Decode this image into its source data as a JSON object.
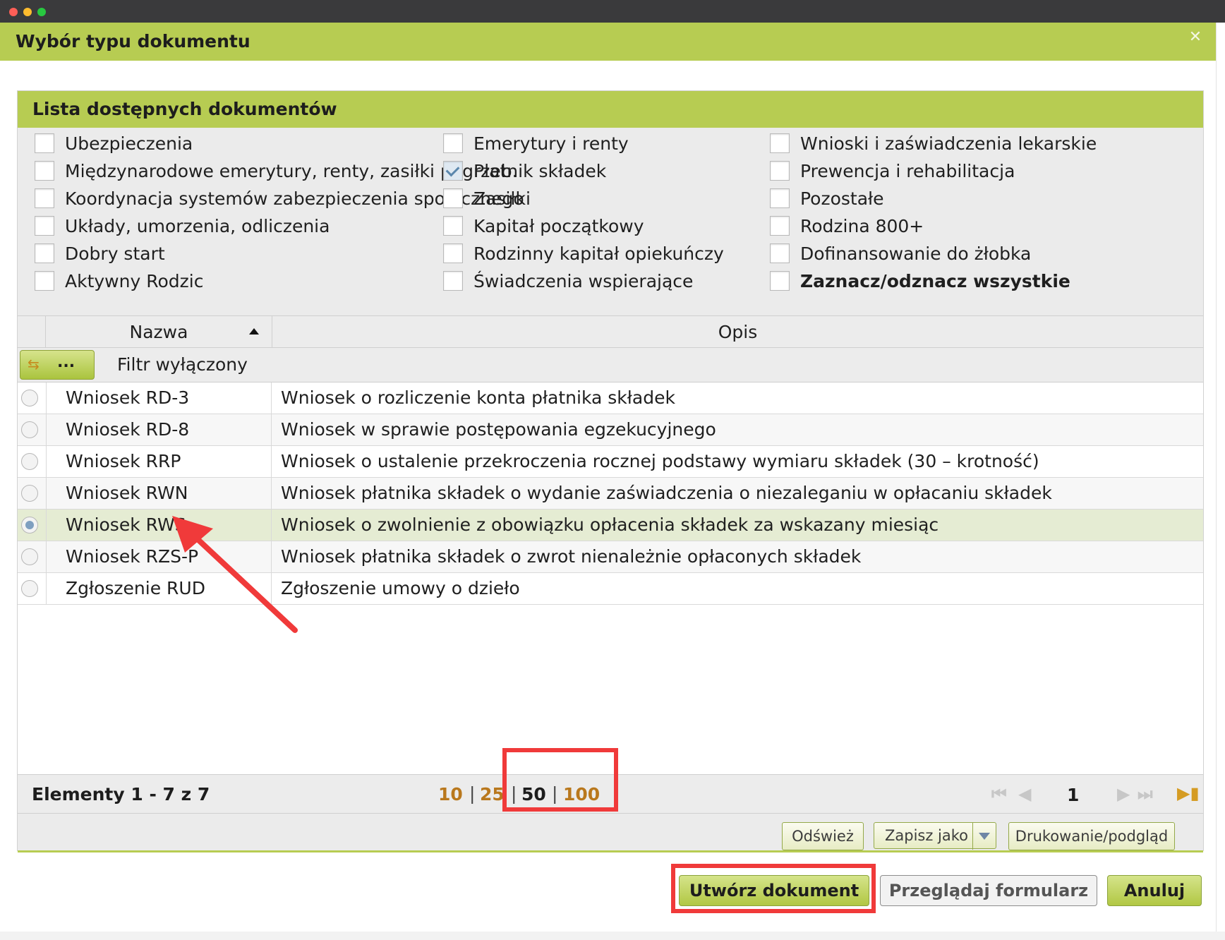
{
  "window": {
    "title": "Wybór typu dokumentu",
    "close_icon": "x-icon"
  },
  "panel": {
    "title": "Lista dostępnych dokumentów",
    "categories": [
      {
        "label": "Ubezpieczenia",
        "checked": false
      },
      {
        "label": "Emerytury i renty",
        "checked": false
      },
      {
        "label": "Wnioski i zaświadczenia lekarskie",
        "checked": false
      },
      {
        "label": "Międzynarodowe emerytury, renty, zasiłki pogrzeb.",
        "checked": false
      },
      {
        "label": "Płatnik składek",
        "checked": true
      },
      {
        "label": "Prewencja i rehabilitacja",
        "checked": false
      },
      {
        "label": "Koordynacja systemów zabezpieczenia społecznego",
        "checked": false
      },
      {
        "label": "Zasiłki",
        "checked": false
      },
      {
        "label": "Pozostałe",
        "checked": false
      },
      {
        "label": "Układy, umorzenia, odliczenia",
        "checked": false
      },
      {
        "label": "Kapitał początkowy",
        "checked": false
      },
      {
        "label": "Rodzina 800+",
        "checked": false
      },
      {
        "label": "Dobry start",
        "checked": false
      },
      {
        "label": "Rodzinny kapitał opiekuńczy",
        "checked": false
      },
      {
        "label": "Dofinansowanie do żłobka",
        "checked": false
      },
      {
        "label": "Aktywny Rodzic",
        "checked": false
      },
      {
        "label": "Świadczenia wspierające",
        "checked": false
      },
      {
        "label": "Zaznacz/odznacz wszystkie",
        "checked": false
      }
    ]
  },
  "grid": {
    "columns": {
      "name": "Nazwa",
      "description": "Opis"
    },
    "filter": {
      "button_label": "...",
      "status": "Filtr wyłączony"
    },
    "rows": [
      {
        "name": "Wniosek RD-3",
        "description": "Wniosek o rozliczenie konta płatnika składek",
        "selected": false
      },
      {
        "name": "Wniosek RD-8",
        "description": "Wniosek w sprawie postępowania egzekucyjnego",
        "selected": false
      },
      {
        "name": "Wniosek RRP",
        "description": "Wniosek o ustalenie przekroczenia rocznej podstawy wymiaru składek (30 – krotność)",
        "selected": false
      },
      {
        "name": "Wniosek RWN",
        "description": "Wniosek płatnika składek o wydanie zaświadczenia o niezaleganiu w opłacaniu składek",
        "selected": false
      },
      {
        "name": "Wniosek RWS",
        "description": "Wniosek o zwolnienie z obowiązku opłacenia składek za wskazany miesiąc",
        "selected": true
      },
      {
        "name": "Wniosek RZS-P",
        "description": "Wniosek płatnika składek o zwrot nienależnie opłaconych składek",
        "selected": false
      },
      {
        "name": "Zgłoszenie RUD",
        "description": "Zgłoszenie umowy o dzieło",
        "selected": false
      }
    ]
  },
  "pager": {
    "info": "Elementy 1 - 7 z 7",
    "sizes": [
      "10",
      "25",
      "50",
      "100"
    ],
    "separator": "|",
    "current_size": "50",
    "current_page": "1"
  },
  "toolbar": {
    "refresh": "Odśwież",
    "save_as": "Zapisz jako",
    "print": "Drukowanie/podgląd"
  },
  "footer": {
    "create": "Utwórz dokument",
    "browse": "Przeglądaj formularz",
    "cancel": "Anuluj"
  },
  "colors": {
    "header_green": "#b7cc52",
    "selected_row": "#e5ecd3",
    "annotation_red": "#f03a3a",
    "link_orange": "#b9781d"
  }
}
